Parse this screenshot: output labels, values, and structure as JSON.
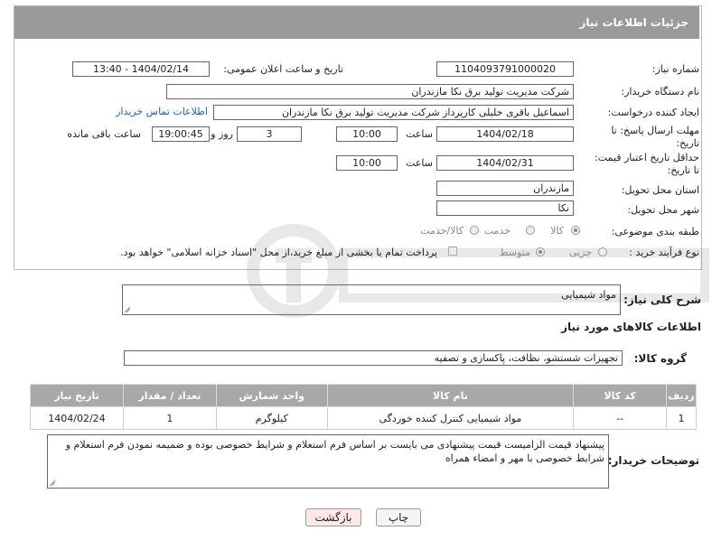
{
  "header": {
    "title": "جزئیات اطلاعات نیاز"
  },
  "fields": {
    "need_number_label": "شماره نیاز:",
    "need_number": "1104093791000020",
    "announce_label": "تاریخ و ساعت اعلان عمومی:",
    "announce_value": "1404/02/14 - 13:40",
    "buyer_org_label": "نام دستگاه خریدار:",
    "buyer_org": "شرکت مدیریت تولید برق نکا  مازندران",
    "requester_label": "ایجاد کننده درخواست:",
    "requester": "اسماعیل باقری خلیلی کارپرداز شرکت مدیریت تولید برق نکا  مازندران",
    "contact_link": "اطلاعات تماس خریدار",
    "deadline_label_1": "مهلت ارسال پاسخ: تا",
    "deadline_label_2": "تاریخ:",
    "deadline_date": "1404/02/18",
    "time_label": "ساعت",
    "deadline_time": "10:00",
    "days_value": "3",
    "days_label": "روز و",
    "remaining_time": "19:00:45",
    "remaining_label": "ساعت باقی مانده",
    "validity_label_1": "حداقل تاریخ اعتبار قیمت:",
    "validity_label_2": "تا تاریخ:",
    "validity_date": "1404/02/31",
    "validity_time": "10:00",
    "province_label": "استان محل تحویل:",
    "province": "مازندران",
    "city_label": "شهر محل تحویل:",
    "city": "نکا",
    "category_label": "طبقه بندی موضوعی:",
    "category_options": [
      "کالا",
      "خدمت",
      "کالا/خدمت"
    ],
    "category_selected": "کالا",
    "process_label": "نوع فرآیند خرید :",
    "process_options": [
      "جزیی",
      "متوسط"
    ],
    "process_selected": "متوسط",
    "payment_note": "پرداخت تمام یا بخشی از مبلغ خرید،از محل \"اسناد خزانه اسلامی\" خواهد بود."
  },
  "description": {
    "label": "شرح کلی نیاز:",
    "value": "مواد شیمیایی"
  },
  "items_section": {
    "title": "اطلاعات کالاهای مورد نیاز",
    "group_label": "گروه کالا:",
    "group_value": "تجهیزات شستشو، نظافت، پاکسازی و تصفیه"
  },
  "table": {
    "headers": [
      "ردیف",
      "کد کالا",
      "نام کالا",
      "واحد شمارش",
      "تعداد / مقدار",
      "تاریخ نیاز"
    ],
    "rows": [
      [
        "1",
        "--",
        "مواد شیمیایی کنترل کننده خوردگی",
        "کیلوگرم",
        "1",
        "1404/02/24"
      ]
    ]
  },
  "buyer_notes": {
    "label": "توضیحات خریدار:",
    "value": "پیشنهاد قیمت الزامیست قیمت پیشنهادی می بایست بر اساس فرم استعلام و شرایط خصوصی بوده و ضمیمه نمودن فرم استعلام و شرایط خصوصی با مهر و امضاء همراه"
  },
  "buttons": {
    "print": "چاپ",
    "back": "بازگشت"
  },
  "colors": {
    "header_bg": "#9a9a9a",
    "link": "#1565c0",
    "back_button_bg": "#fde8e8"
  }
}
